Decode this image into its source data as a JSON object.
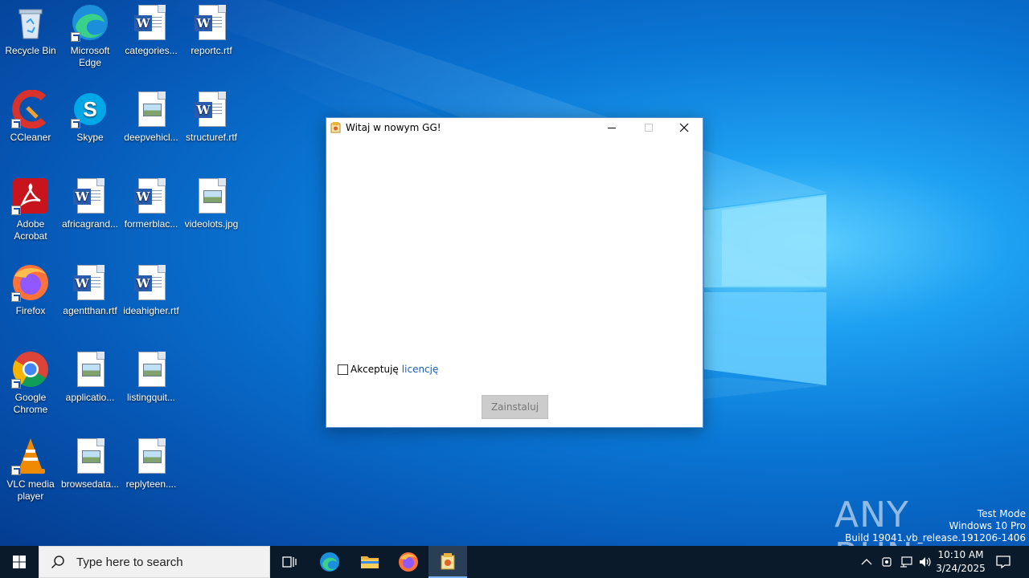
{
  "desktop": {
    "icons": [
      {
        "label": "Recycle Bin",
        "icon": "recycle-bin-icon"
      },
      {
        "label": "Microsoft Edge",
        "icon": "edge-icon"
      },
      {
        "label": "categories...",
        "icon": "word-doc-icon"
      },
      {
        "label": "reportc.rtf",
        "icon": "word-doc-icon"
      },
      {
        "label": "CCleaner",
        "icon": "ccleaner-icon"
      },
      {
        "label": "Skype",
        "icon": "skype-icon"
      },
      {
        "label": "deepvehicl...",
        "icon": "image-file-icon"
      },
      {
        "label": "structuref.rtf",
        "icon": "word-doc-icon"
      },
      {
        "label": "Adobe Acrobat",
        "icon": "acrobat-icon"
      },
      {
        "label": "africagrand...",
        "icon": "word-doc-icon"
      },
      {
        "label": "formerblac...",
        "icon": "word-doc-icon"
      },
      {
        "label": "videolots.jpg",
        "icon": "image-file-icon"
      },
      {
        "label": "Firefox",
        "icon": "firefox-icon"
      },
      {
        "label": "agentthan.rtf",
        "icon": "word-doc-icon"
      },
      {
        "label": "ideahigher.rtf",
        "icon": "word-doc-icon"
      },
      {
        "label": "Google Chrome",
        "icon": "chrome-icon"
      },
      {
        "label": "applicatio...",
        "icon": "image-file-icon"
      },
      {
        "label": "listingquit...",
        "icon": "image-file-icon"
      },
      {
        "label": "VLC media player",
        "icon": "vlc-icon"
      },
      {
        "label": "browsedata...",
        "icon": "image-file-icon"
      },
      {
        "label": "replyteen....",
        "icon": "image-file-icon"
      }
    ]
  },
  "dialog": {
    "title": "Witaj w nowym GG!",
    "accept_label": "Akceptuję",
    "license_link": "licencję",
    "install_button": "Zainstaluj",
    "checkbox_checked": false
  },
  "watermark": {
    "brand": "ANY RUN",
    "line1": "Test Mode",
    "line2": "Windows 10 Pro",
    "line3": "Build 19041.vb_release.191206-1406"
  },
  "taskbar": {
    "search_placeholder": "Type here to search",
    "time": "10:10 AM",
    "date": "3/24/2025"
  },
  "colors": {
    "taskbar_bg": "#0b1a2b",
    "link": "#1a5fb4",
    "desktop_blue": "#0a78d6"
  }
}
